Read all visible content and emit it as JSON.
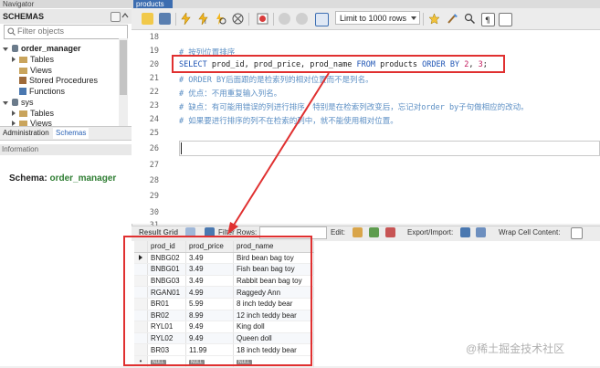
{
  "navigator": {
    "title": "Navigator",
    "schemas_label": "SCHEMAS",
    "filter_placeholder": "Filter objects",
    "tree": [
      {
        "label": "order_manager",
        "children": [
          "Tables",
          "Views",
          "Stored Procedures",
          "Functions"
        ]
      },
      {
        "label": "sys",
        "children": [
          "Tables",
          "Views"
        ]
      }
    ],
    "tabs": [
      "Administration",
      "Schemas"
    ],
    "information_label": "Information",
    "schema_prefix": "Schema:",
    "schema_name": "order_manager"
  },
  "editor": {
    "tab_title": "products",
    "limit_select": "Limit to 1000 rows",
    "lines": [
      {
        "n": "18",
        "parts": []
      },
      {
        "n": "19",
        "parts": [
          {
            "t": "# 按列位置排序",
            "c": "cmt"
          }
        ]
      },
      {
        "n": "20",
        "parts": [
          {
            "t": "SELECT ",
            "c": "kw"
          },
          {
            "t": "prod_id, prod_price, prod_name ",
            "c": ""
          },
          {
            "t": "FROM ",
            "c": "kw"
          },
          {
            "t": "products ",
            "c": ""
          },
          {
            "t": "ORDER BY ",
            "c": "kw"
          },
          {
            "t": "2",
            "c": "num"
          },
          {
            "t": ", ",
            "c": ""
          },
          {
            "t": "3",
            "c": "num"
          },
          {
            "t": ";",
            "c": ""
          }
        ]
      },
      {
        "n": "21",
        "parts": [
          {
            "t": "# ORDER BY后面跟的是检索列的相对位置而不是列名。",
            "c": "cmt"
          }
        ]
      },
      {
        "n": "22",
        "parts": [
          {
            "t": "# 优点：不用重复输入列名。",
            "c": "cmt"
          }
        ]
      },
      {
        "n": "23",
        "parts": [
          {
            "t": "# 缺点：有可能用错误的列进行排序，特别是在检索列改变后，忘记对order by子句做相应的改动。",
            "c": "cmt"
          }
        ]
      },
      {
        "n": "24",
        "parts": [
          {
            "t": "# 如果要进行排序的列不在检索的列中，就不能使用相对位置。",
            "c": "cmt"
          }
        ]
      },
      {
        "n": "25",
        "parts": []
      },
      {
        "n": "26",
        "parts": []
      },
      {
        "n": "27",
        "parts": []
      },
      {
        "n": "28",
        "parts": []
      },
      {
        "n": "29",
        "parts": []
      },
      {
        "n": "30",
        "parts": []
      },
      {
        "n": "31",
        "parts": []
      }
    ]
  },
  "result_bar": {
    "result_grid": "Result Grid",
    "filter_rows": "Filter Rows:",
    "edit": "Edit:",
    "export_import": "Export/Import:",
    "wrap_cell": "Wrap Cell Content:"
  },
  "grid": {
    "columns": [
      "prod_id",
      "prod_price",
      "prod_name"
    ],
    "rows": [
      [
        "BNBG02",
        "3.49",
        "Bird bean bag toy"
      ],
      [
        "BNBG01",
        "3.49",
        "Fish bean bag toy"
      ],
      [
        "BNBG03",
        "3.49",
        "Rabbit bean bag toy"
      ],
      [
        "RGAN01",
        "4.99",
        "Raggedy Ann"
      ],
      [
        "BR01",
        "5.99",
        "8 inch teddy bear"
      ],
      [
        "BR02",
        "8.99",
        "12 inch teddy bear"
      ],
      [
        "RYL01",
        "9.49",
        "King doll"
      ],
      [
        "RYL02",
        "9.49",
        "Queen doll"
      ],
      [
        "BR03",
        "11.99",
        "18 inch teddy bear"
      ]
    ],
    "null_label": "NULL"
  },
  "watermark": "@稀土掘金技术社区",
  "colors": {
    "highlight": "#e03030",
    "keyword": "#1f55b5",
    "comment": "#5c8fc4",
    "number": "#c2185b",
    "schema_name": "#2e7d32"
  }
}
